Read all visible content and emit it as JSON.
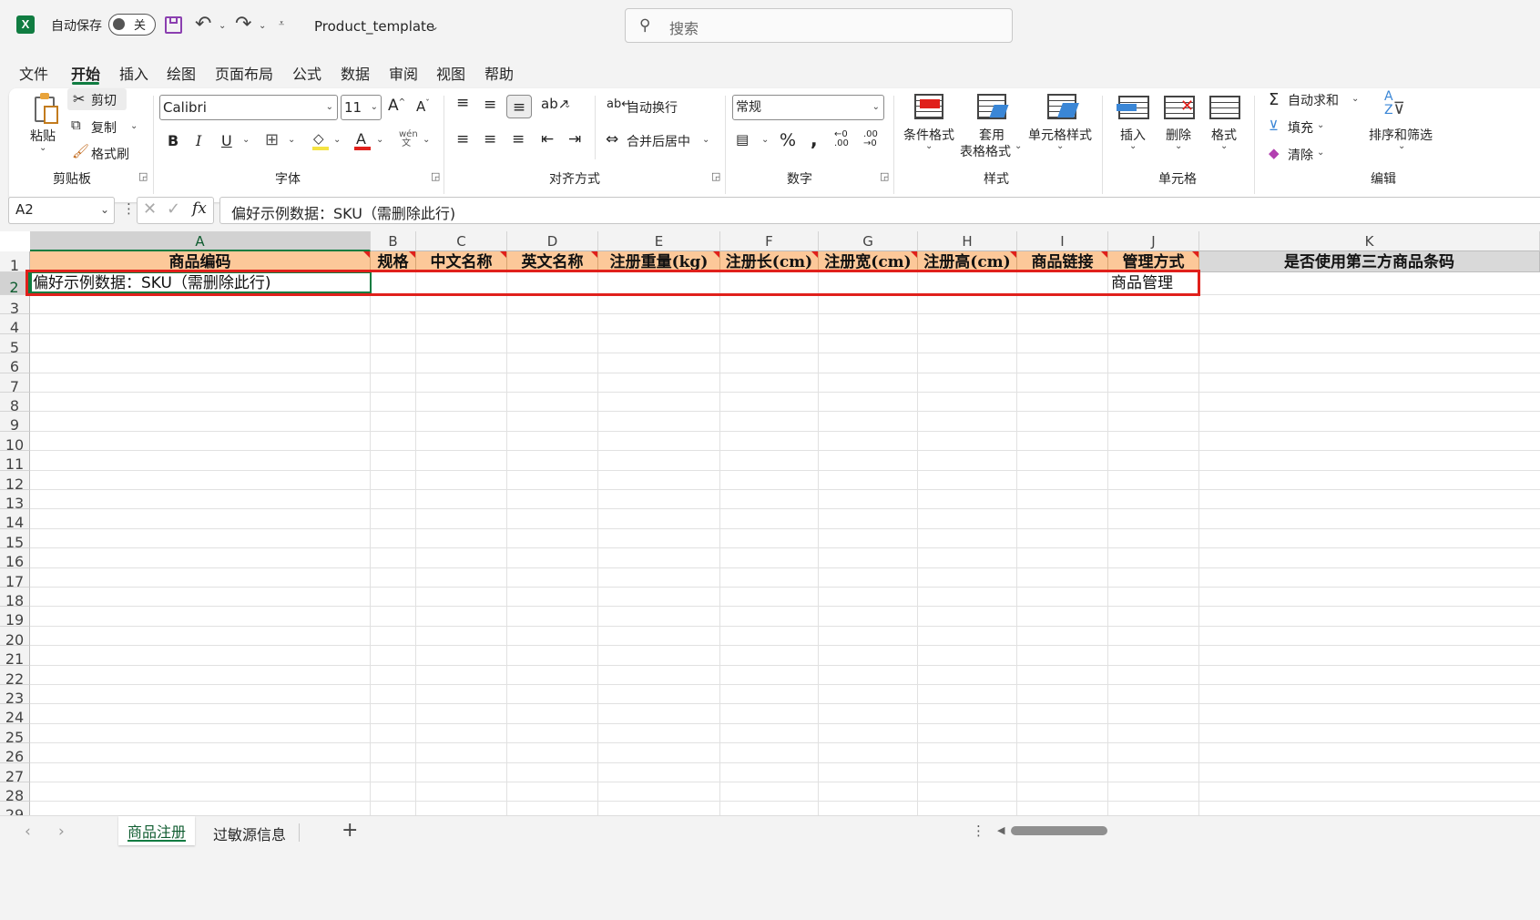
{
  "titlebar": {
    "autosave_label": "自动保存",
    "autosave_state": "关",
    "filename": "Product_template",
    "search_placeholder": "搜索"
  },
  "menu": [
    "文件",
    "开始",
    "插入",
    "绘图",
    "页面布局",
    "公式",
    "数据",
    "审阅",
    "视图",
    "帮助"
  ],
  "ribbon": {
    "clipboard": {
      "paste": "粘贴",
      "cut": "剪切",
      "copy": "复制",
      "format_painter": "格式刷",
      "label": "剪贴板"
    },
    "font": {
      "name": "Calibri",
      "size": "11",
      "label": "字体"
    },
    "alignment": {
      "wrap": "自动换行",
      "merge": "合并后居中",
      "label": "对齐方式"
    },
    "number": {
      "format": "常规",
      "label": "数字"
    },
    "styles": {
      "conditional": "条件格式",
      "table_format_1": "套用",
      "table_format_2": "表格格式",
      "cell_style": "单元格样式",
      "label": "样式"
    },
    "cells": {
      "insert": "插入",
      "delete": "删除",
      "format": "格式",
      "label": "单元格"
    },
    "editing": {
      "autosum": "自动求和",
      "fill": "填充",
      "clear": "清除",
      "sort": "排序和筛选",
      "label": "编辑"
    }
  },
  "formula_bar": {
    "name_box": "A2",
    "content": "偏好示例数据：SKU（需删除此行)"
  },
  "columns": [
    "A",
    "B",
    "C",
    "D",
    "E",
    "F",
    "G",
    "H",
    "I",
    "J",
    "K"
  ],
  "rows": [
    "1",
    "2",
    "3",
    "4",
    "5",
    "6",
    "7",
    "8",
    "9",
    "10",
    "11",
    "12",
    "13",
    "14",
    "15",
    "16",
    "17",
    "18",
    "19",
    "20",
    "21",
    "22",
    "23",
    "24",
    "25",
    "26",
    "27",
    "28",
    "29"
  ],
  "header_row": [
    "商品编码",
    "规格",
    "中文名称",
    "英文名称",
    "注册重量(kg)",
    "注册长(cm)",
    "注册宽(cm)",
    "注册高(cm)",
    "商品链接",
    "管理方式",
    "是否使用第三方商品条码"
  ],
  "row2": {
    "a": "偏好示例数据：SKU（需删除此行)",
    "j": "商品管理"
  },
  "sheets": [
    "商品注册",
    "过敏源信息"
  ],
  "colors": {
    "accent": "#107c41",
    "header_fill": "#fcc899",
    "highlight": "#e0201b"
  }
}
